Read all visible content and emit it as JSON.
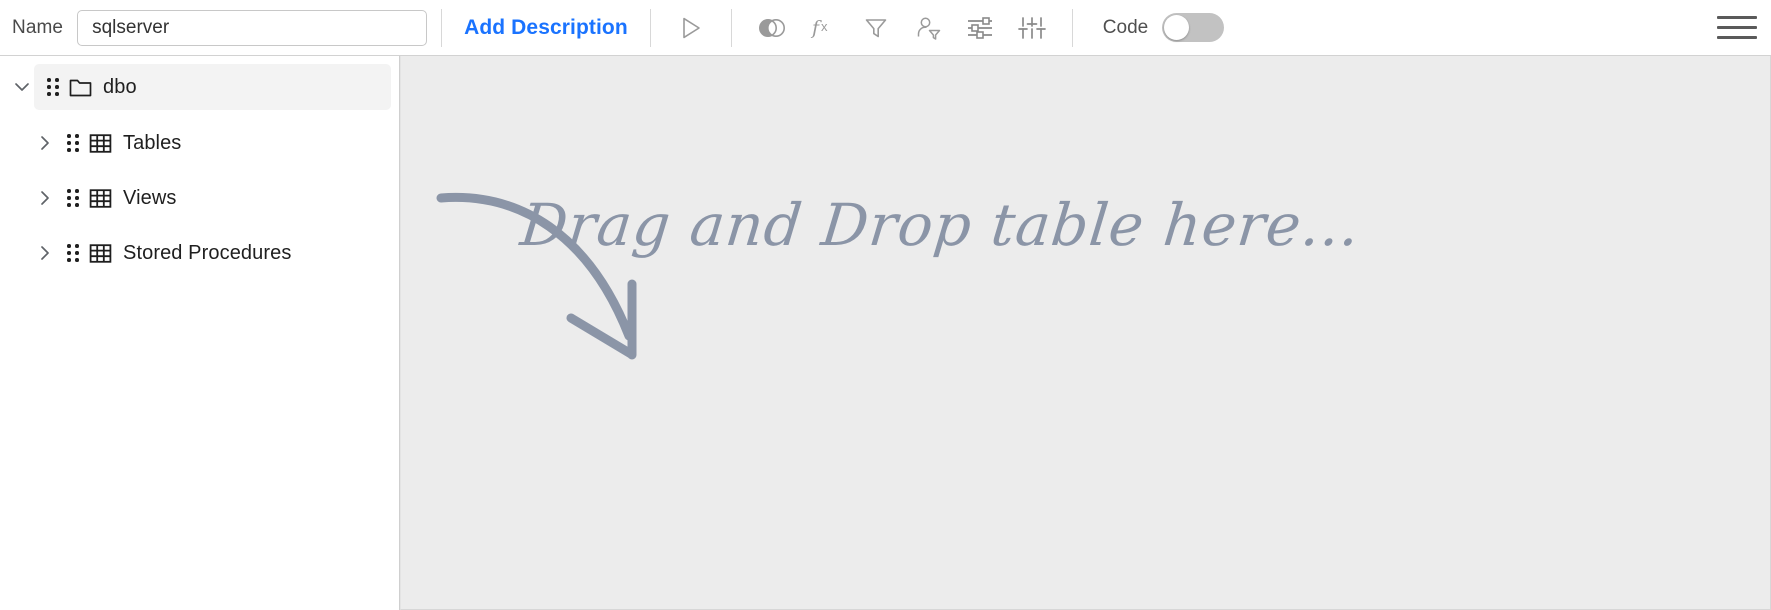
{
  "toolbar": {
    "name_label": "Name",
    "name_value": "sqlserver",
    "name_placeholder": "Name",
    "add_description_label": "Add Description",
    "code_label": "Code",
    "code_toggle_state": "off",
    "accent_color": "#1a73ff",
    "icons": [
      {
        "name": "run-icon",
        "title": "Run"
      },
      {
        "name": "join-icon",
        "title": "Join"
      },
      {
        "name": "function-icon",
        "title": "fx"
      },
      {
        "name": "filter-icon",
        "title": "Filter"
      },
      {
        "name": "group-by-icon",
        "title": "Group By"
      },
      {
        "name": "sliders-horizontal-icon",
        "title": "Settings"
      },
      {
        "name": "sort-order-icon",
        "title": "Sort"
      }
    ],
    "menu_icon": "hamburger-menu-icon"
  },
  "sidebar": {
    "items": [
      {
        "label": "dbo",
        "icon": "folder-icon",
        "expanded": true,
        "selected": true,
        "level": 0
      },
      {
        "label": "Tables",
        "icon": "table-icon",
        "expanded": false,
        "selected": false,
        "level": 1
      },
      {
        "label": "Views",
        "icon": "table-icon",
        "expanded": false,
        "selected": false,
        "level": 1
      },
      {
        "label": "Stored Procedures",
        "icon": "table-icon",
        "expanded": false,
        "selected": false,
        "level": 1
      }
    ]
  },
  "canvas": {
    "drop_hint_text": "Drag and Drop table here...",
    "arrow_icon": "curved-arrow-icon",
    "background_color": "#ececec",
    "hint_color": "#8b95a7"
  }
}
